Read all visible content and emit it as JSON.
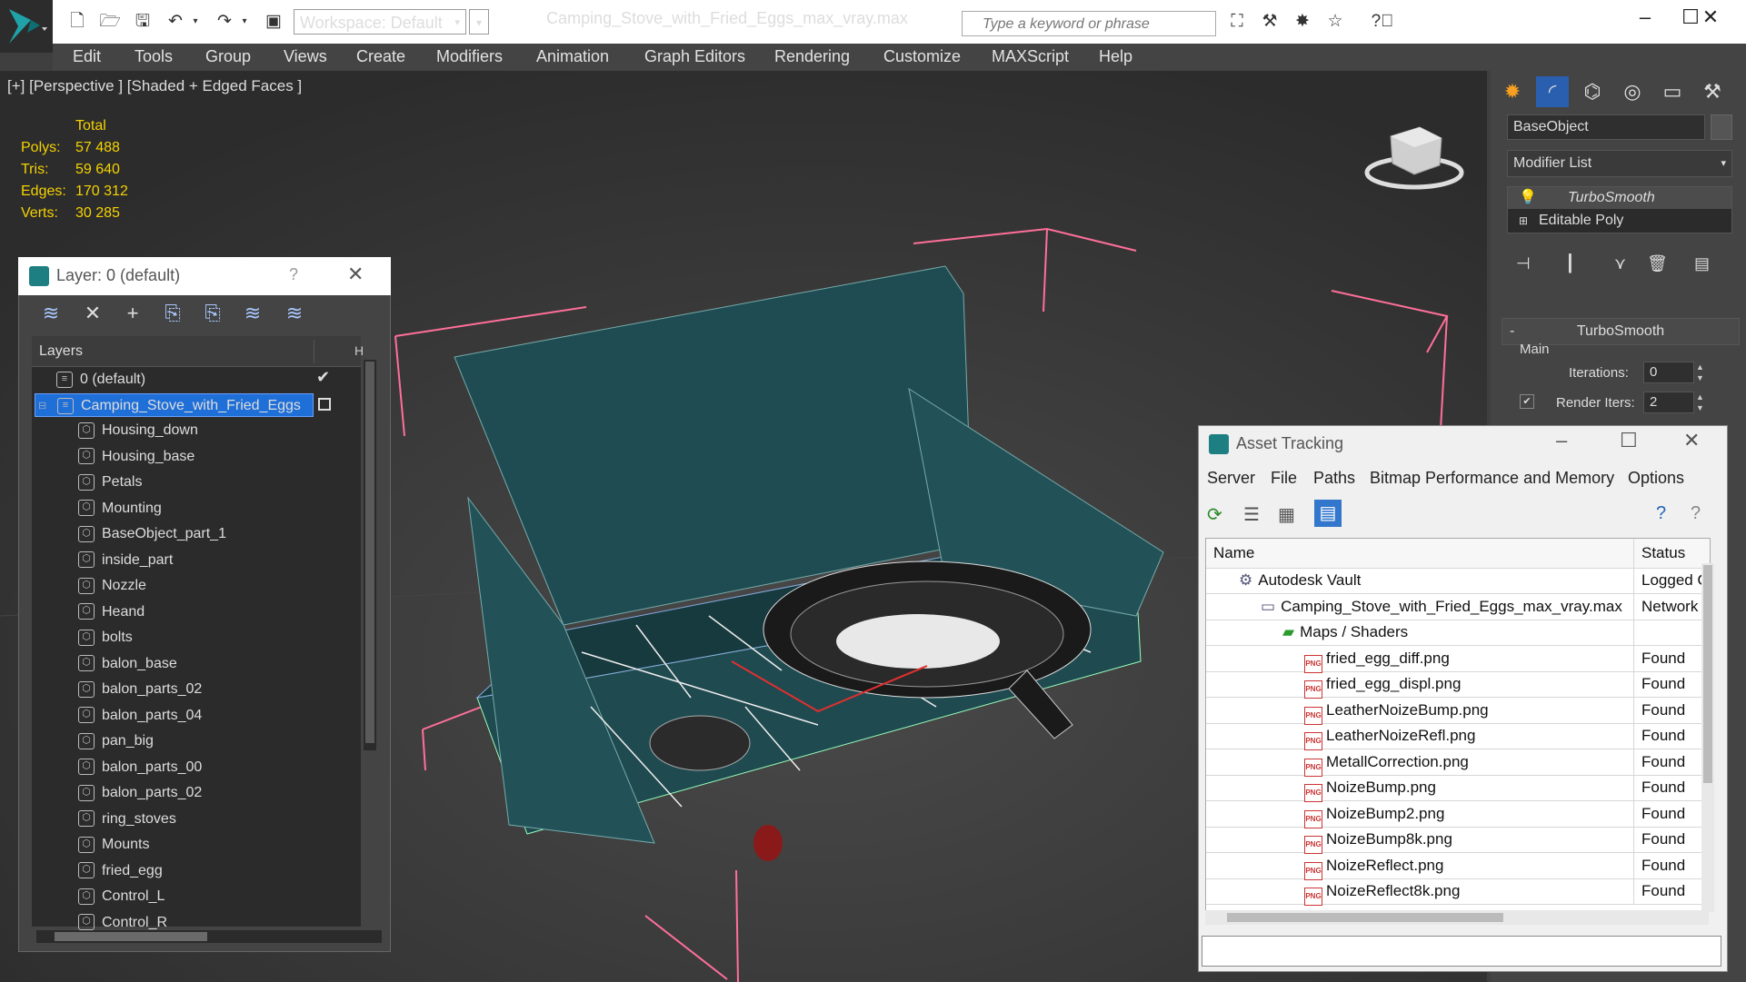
{
  "titlebar": {
    "workspace": "Workspace: Default",
    "document_title": "Camping_Stove_with_Fried_Eggs_max_vray.max",
    "search_placeholder": "Type a keyword or phrase"
  },
  "menubar": {
    "items": [
      "Edit",
      "Tools",
      "Group",
      "Views",
      "Create",
      "Modifiers",
      "Animation",
      "Graph Editors",
      "Rendering",
      "Customize",
      "MAXScript",
      "Help"
    ]
  },
  "viewport": {
    "label": "[+] [Perspective ] [Shaded + Edged Faces ]",
    "stats": {
      "header": "Total",
      "rows": [
        {
          "label": "Polys:",
          "value": "57 488"
        },
        {
          "label": "Tris:",
          "value": "59 640"
        },
        {
          "label": "Edges:",
          "value": "170 312"
        },
        {
          "label": "Verts:",
          "value": "30 285"
        }
      ]
    }
  },
  "command_panel": {
    "object_name": "BaseObject",
    "modifier_list": "Modifier List",
    "stack": [
      "TurboSmooth",
      "Editable Poly"
    ],
    "rollout_title": "TurboSmooth",
    "group_label": "Main",
    "iterations_label": "Iterations:",
    "iterations_value": "0",
    "render_iters_label": "Render Iters:",
    "render_iters_value": "2"
  },
  "layer_window": {
    "title": "Layer: 0 (default)",
    "help": "?",
    "column_header": "Layers",
    "layers": [
      {
        "name": "0 (default)",
        "level": 0,
        "checked": true
      },
      {
        "name": "Camping_Stove_with_Fried_Eggs",
        "level": 0,
        "selected": true
      }
    ],
    "objects": [
      "Housing_down",
      "Housing_base",
      "Petals",
      "Mounting",
      "BaseObject_part_1",
      "inside_part",
      "Nozzle",
      "Heand",
      "bolts",
      "balon_base",
      "balon_parts_02",
      "balon_parts_04",
      "pan_big",
      "balon_parts_00",
      "balon_parts_02",
      "ring_stoves",
      "Mounts",
      "fried_egg",
      "Control_L",
      "Control_R"
    ]
  },
  "asset_tracking": {
    "title": "Asset Tracking",
    "menu": [
      "Server",
      "File",
      "Paths",
      "Bitmap Performance and Memory",
      "Options"
    ],
    "columns": {
      "name": "Name",
      "status": "Status"
    },
    "rows": [
      {
        "name": "Autodesk Vault",
        "status": "Logged O",
        "indent": 1,
        "icon": "vault-icon"
      },
      {
        "name": "Camping_Stove_with_Fried_Eggs_max_vray.max",
        "status": "Network",
        "indent": 2,
        "icon": "max-file-icon"
      },
      {
        "name": "Maps / Shaders",
        "status": "",
        "indent": 3,
        "icon": "maps-icon"
      },
      {
        "name": "fried_egg_diff.png",
        "status": "Found",
        "indent": 4,
        "icon": "png-icon"
      },
      {
        "name": "fried_egg_displ.png",
        "status": "Found",
        "indent": 4,
        "icon": "png-icon"
      },
      {
        "name": "LeatherNoizeBump.png",
        "status": "Found",
        "indent": 4,
        "icon": "png-icon"
      },
      {
        "name": "LeatherNoizeRefl.png",
        "status": "Found",
        "indent": 4,
        "icon": "png-icon"
      },
      {
        "name": "MetallCorrection.png",
        "status": "Found",
        "indent": 4,
        "icon": "png-icon"
      },
      {
        "name": "NoizeBump.png",
        "status": "Found",
        "indent": 4,
        "icon": "png-icon"
      },
      {
        "name": "NoizeBump2.png",
        "status": "Found",
        "indent": 4,
        "icon": "png-icon"
      },
      {
        "name": "NoizeBump8k.png",
        "status": "Found",
        "indent": 4,
        "icon": "png-icon"
      },
      {
        "name": "NoizeReflect.png",
        "status": "Found",
        "indent": 4,
        "icon": "png-icon"
      },
      {
        "name": "NoizeReflect8k.png",
        "status": "Found",
        "indent": 4,
        "icon": "png-icon"
      }
    ]
  },
  "colors": {
    "accent_blue": "#1f6fd8",
    "stats_yellow": "#f5d200",
    "viewport_bg": "#3a3a3a",
    "selection_box": "#ff6f9a"
  }
}
